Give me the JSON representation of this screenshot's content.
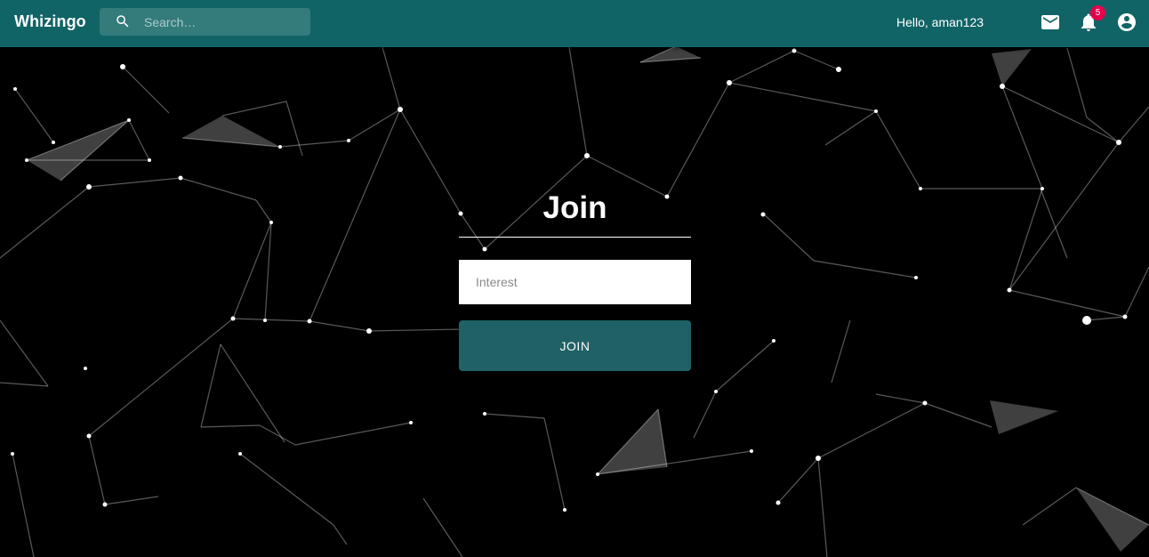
{
  "app": {
    "brand": "Whizingo"
  },
  "search": {
    "placeholder": "Search…",
    "icon": "search-icon"
  },
  "user": {
    "greeting": "Hello, aman123"
  },
  "header_icons": {
    "mail": "mail-icon",
    "notifications": "bell-icon",
    "account": "account-circle-icon"
  },
  "notifications": {
    "count": "5"
  },
  "join_form": {
    "title": "Join",
    "interest_placeholder": "Interest",
    "interest_value": "",
    "button_label": "JOIN"
  },
  "colors": {
    "appbar": "#116466",
    "button": "#1f6166",
    "badge": "#e6004c",
    "background": "#000000"
  }
}
